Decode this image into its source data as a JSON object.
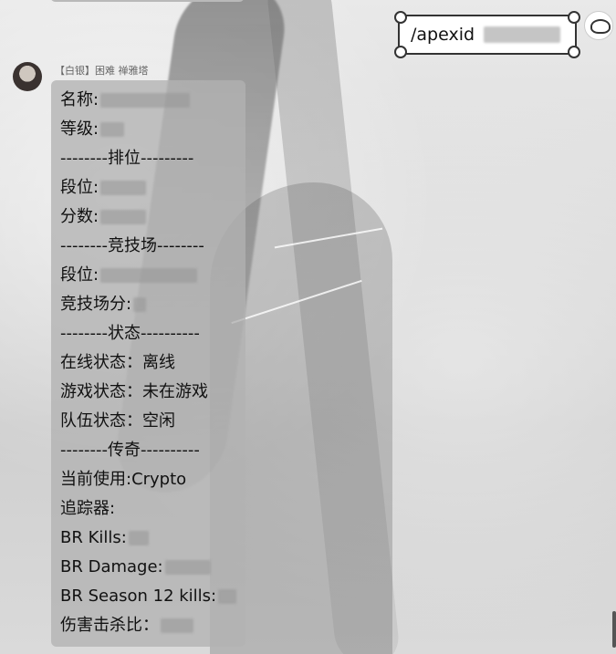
{
  "my_message": {
    "command": "/apexid"
  },
  "bot": {
    "name": "【白银】困难 禅雅塔",
    "lines": [
      "名称:",
      "等级:",
      "--------排位---------",
      "段位:",
      "分数:",
      "--------竞技场--------",
      "段位:",
      "竞技场分:",
      "--------状态----------",
      "在线状态：离线",
      "游戏状态：未在游戏",
      "队伍状态：空闲",
      "--------传奇----------",
      "当前使用:Crypto",
      "追踪器:",
      "BR Kills:",
      "BR Damage:",
      "BR Season 12 kills:",
      "伤害击杀比："
    ]
  },
  "colors": {
    "bubble": "#b2b2b2",
    "background": "#d3d3d3",
    "text": "#111111"
  }
}
